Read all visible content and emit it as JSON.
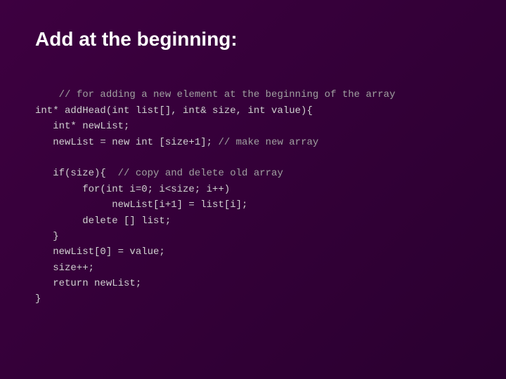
{
  "slide": {
    "title": "Add at the beginning:",
    "code_lines": [
      "// for adding a new element at the beginning of the array",
      "int* addHead(int list[], int& size, int value){",
      "   int* newList;",
      "   newList = new int [size+1]; // make new array",
      "",
      "   if(size){  // copy and delete old array",
      "        for(int i=0; i<size; i++)",
      "             newList[i+1] = list[i];",
      "        delete [] list;",
      "   }",
      "   newList[0] = value;",
      "   size++;",
      "   return newList;",
      "}"
    ]
  },
  "colors": {
    "background": "#3d0040",
    "title": "#ffffff",
    "code": "#d0d0d0"
  }
}
